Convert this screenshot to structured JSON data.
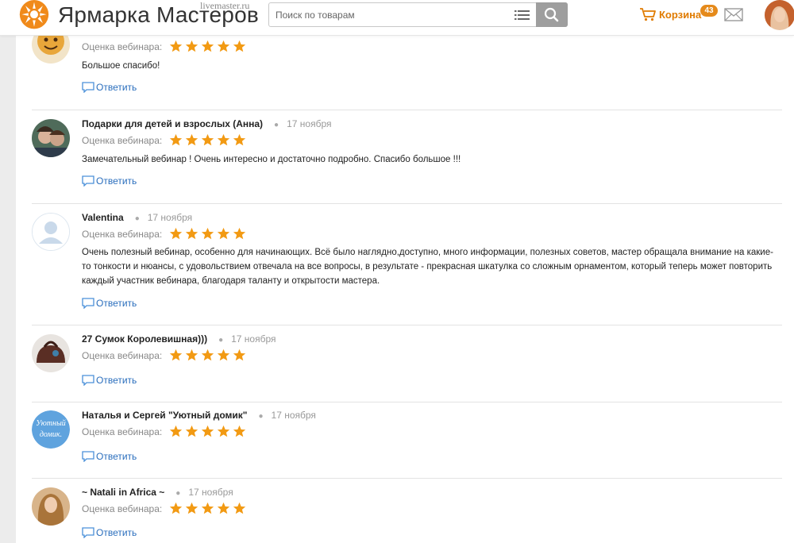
{
  "header": {
    "logo_title": "Ярмарка Мастеров",
    "logo_domain": "livemaster.ru",
    "search_placeholder": "Поиск по товарам",
    "cart_label": "Корзина",
    "cart_count": "43"
  },
  "rating_label": "Оценка вебинара:",
  "reply_label": "Ответить",
  "comments": [
    {
      "author": "",
      "date": "",
      "rating": 5,
      "text": "Большое спасибо!"
    },
    {
      "author": "Подарки для детей и взрослых (Анна)",
      "date": "17 ноября",
      "rating": 5,
      "text": "Замечательный вебинар ! Очень интересно и достаточно подробно. Спасибо большое !!!"
    },
    {
      "author": "Valentina",
      "date": "17 ноября",
      "rating": 5,
      "text": "Очень полезный вебинар, особенно для начинающих. Всё было наглядно,доступно, много информации, полезных советов, мастер обращала внимание на какие-то тонкости и нюансы, с удовольствием отвечала на все вопросы, в результате - прекрасная шкатулка со сложным орнаментом, который теперь может повторить каждый участник вебинара, благодаря таланту и открытости мастера."
    },
    {
      "author": "27 Сумок Королевишная)))",
      "date": "17 ноября",
      "rating": 5,
      "text": ""
    },
    {
      "author": "Наталья и Сергей \"Уютный домик\"",
      "date": "17 ноября",
      "rating": 5,
      "text": "",
      "avatar_text_1": "Уютный",
      "avatar_text_2": "домик."
    },
    {
      "author": "~ Natali in Africa ~",
      "date": "17 ноября",
      "rating": 5,
      "text": ""
    }
  ],
  "colors": {
    "accent": "#f08a1a",
    "star": "#f29a13",
    "link": "#2a6ebd",
    "cart": "#e07b00"
  }
}
